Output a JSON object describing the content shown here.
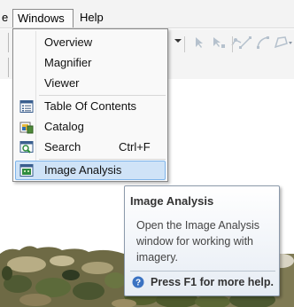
{
  "menubar": {
    "file_stub": "e",
    "windows": "Windows",
    "help": "Help"
  },
  "windows_menu": {
    "items": [
      {
        "label": "Overview",
        "icon": "none"
      },
      {
        "label": "Magnifier",
        "icon": "none"
      },
      {
        "label": "Viewer",
        "icon": "none"
      },
      {
        "label": "Table Of Contents",
        "icon": "table-of-contents-icon"
      },
      {
        "label": "Catalog",
        "icon": "catalog-icon"
      },
      {
        "label": "Search",
        "icon": "search-window-icon",
        "shortcut": "Ctrl+F"
      },
      {
        "label": "Image Analysis",
        "icon": "image-analysis-icon",
        "highlighted": true
      }
    ]
  },
  "tooltip": {
    "title": "Image Analysis",
    "body": "Open the Image Analysis window for working with imagery.",
    "help": "Press F1 for more help."
  },
  "colors": {
    "highlight_bg": "#cfe3f7",
    "highlight_border": "#7eb4ea",
    "menubar_bg": "#f3f3f3",
    "help_icon_blue": "#3a72c2"
  }
}
